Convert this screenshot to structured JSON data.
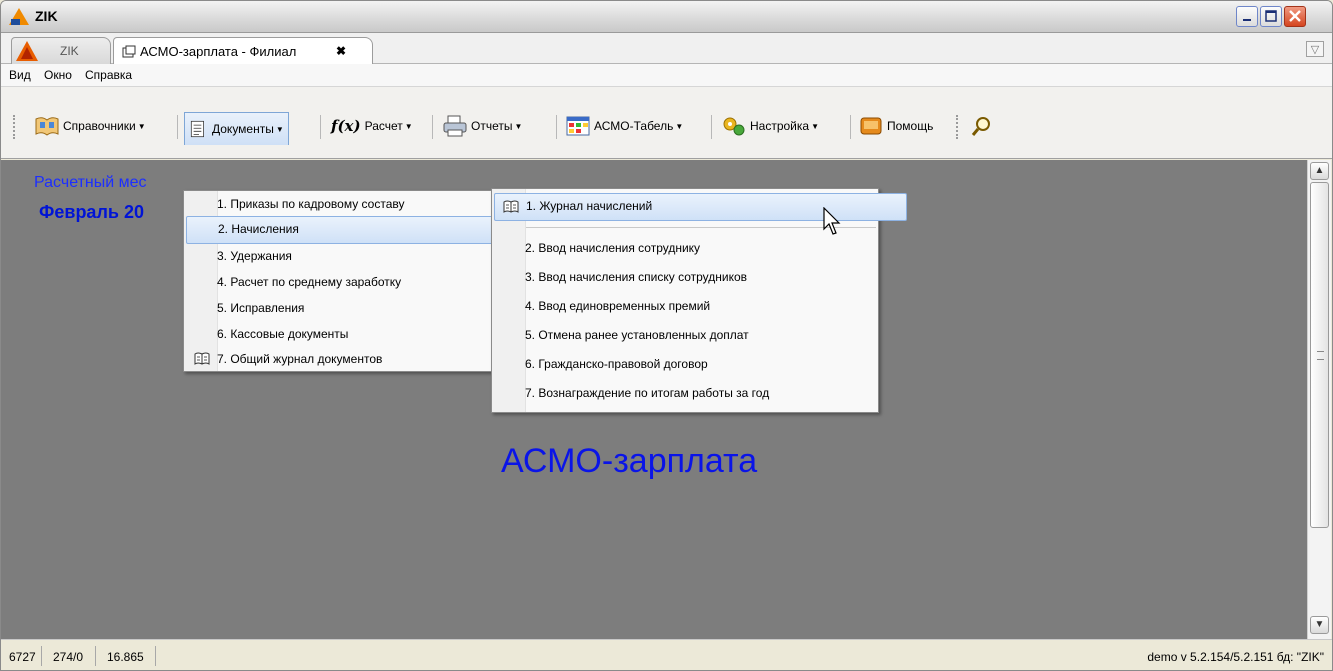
{
  "window": {
    "title": "ZIK"
  },
  "tabs": [
    {
      "label": "ZIK"
    },
    {
      "label": "АСМО-зарплата - Филиал"
    }
  ],
  "menubar": [
    "Вид",
    "Окно",
    "Справка"
  ],
  "toolbar": {
    "directories": "Справочники",
    "documents": "Документы",
    "calc": "Расчет",
    "reports": "Отчеты",
    "timesheet": "АСМО-Табель",
    "settings": "Настройка",
    "help": "Помощь"
  },
  "main": {
    "period_label": "Расчетный мес",
    "period_value": "Февраль 20",
    "caption": "АСМО-зарплата"
  },
  "documents_menu": [
    "1. Приказы по кадровому составу",
    "2. Начисления",
    "3. Удержания",
    "4. Расчет по среднему заработку",
    "5. Исправления",
    "6. Кассовые документы",
    "7. Общий журнал документов"
  ],
  "accruals_submenu": [
    "1. Журнал начислений",
    "2. Ввод начисления сотруднику",
    "3. Ввод начисления списку сотрудников",
    "4. Ввод единовременных премий",
    "5. Отмена ранее установленных доплат",
    "6. Гражданско-правовой договор",
    "7. Вознаграждение по итогам работы за год"
  ],
  "statusbar": {
    "s1": "6727",
    "s2": "274/0",
    "s3": "16.865",
    "right": "demo  v 5.2.154/5.2.151 бд: \"ZIK\""
  },
  "colors": {
    "main_bg": "#7d7d7d",
    "accent_text": "#0a14e8",
    "highlight": "#cfe1f7"
  }
}
